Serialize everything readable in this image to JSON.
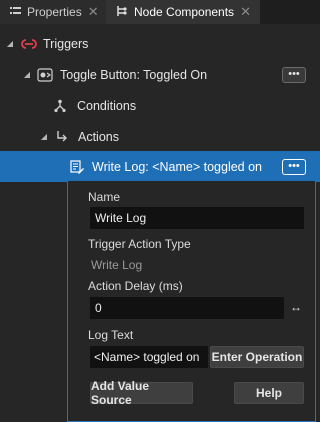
{
  "tabs": [
    {
      "label": "Properties",
      "close": "✕"
    },
    {
      "label": "Node Components",
      "close": "✕"
    }
  ],
  "tree": {
    "triggers": "Triggers",
    "toggle_button": "Toggle Button: Toggled On",
    "conditions": "Conditions",
    "actions": "Actions",
    "write_log": "Write Log: <Name> toggled on",
    "more": "•••"
  },
  "editor": {
    "name_label": "Name",
    "name_value": "Write Log",
    "type_label": "Trigger Action Type",
    "type_value": "Write Log",
    "delay_label": "Action Delay (ms)",
    "delay_value": "0",
    "log_label": "Log Text",
    "log_value": "<Name> toggled on",
    "enter_operation": "Enter Operation",
    "add_value_source": "Add Value Source",
    "help": "Help"
  },
  "colors": {
    "selection": "#1f6fb7",
    "trigger_icon": "#e0404a"
  }
}
